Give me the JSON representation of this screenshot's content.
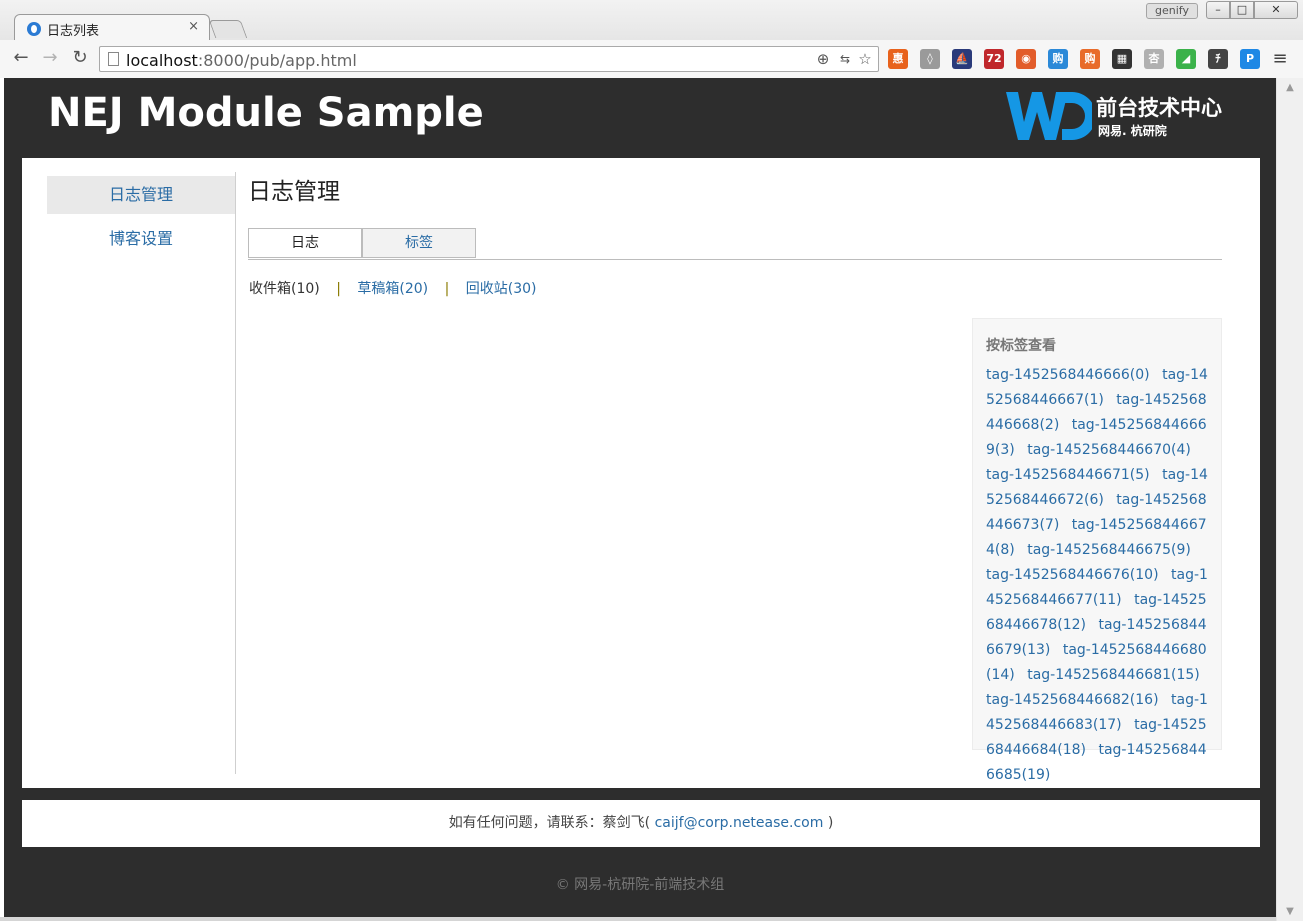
{
  "browser": {
    "tab_title": "日志列表",
    "tab_close": "×",
    "user_badge": "genify",
    "win_min": "–",
    "win_max": "□",
    "win_close": "✕",
    "back": "←",
    "forward": "→",
    "reload": "↻",
    "url_host": "localhost",
    "url_rest": ":8000/pub/app.html",
    "zoom_icon": "⊕",
    "star_icon": "☆",
    "menu_icon": "≡"
  },
  "extensions": [
    {
      "name": "hui-extension-icon",
      "glyph": "惠",
      "color": "#e8621c"
    },
    {
      "name": "shield-extension-icon",
      "glyph": "◊",
      "color": "#9a9a9a"
    },
    {
      "name": "boat-extension-icon",
      "glyph": "⛵",
      "color": "#2a3a7a"
    },
    {
      "name": "badge-extension-icon",
      "glyph": "72",
      "color": "#c0282c"
    },
    {
      "name": "eye-extension-icon",
      "glyph": "◉",
      "color": "#e25c2a"
    },
    {
      "name": "gou-blue-extension-icon",
      "glyph": "购",
      "color": "#2b89d8"
    },
    {
      "name": "gou-orange-extension-icon",
      "glyph": "购",
      "color": "#e86b2a"
    },
    {
      "name": "qrcode-extension-icon",
      "glyph": "▦",
      "color": "#333333"
    },
    {
      "name": "leaf-extension-icon",
      "glyph": "杏",
      "color": "#b0b0b0"
    },
    {
      "name": "flag-extension-icon",
      "glyph": "◢",
      "color": "#3bb24a"
    },
    {
      "name": "tool-extension-icon",
      "glyph": "ﾁ",
      "color": "#444444"
    },
    {
      "name": "p-extension-icon",
      "glyph": "P",
      "color": "#1e88e5"
    }
  ],
  "site": {
    "title": "NEJ Module Sample",
    "logo_line1": "前台技术中心",
    "logo_line2": "网易. 杭研院"
  },
  "sidebar": {
    "items": [
      {
        "label": "日志管理",
        "active": true
      },
      {
        "label": "博客设置",
        "active": false
      }
    ]
  },
  "main": {
    "heading": "日志管理",
    "tabs": [
      "日志",
      "标签"
    ],
    "boxes": {
      "inbox": "收件箱(10)",
      "drafts": "草稿箱(20)",
      "trash": "回收站(30)",
      "sep": "|"
    },
    "tag_panel": {
      "title": "按标签查看",
      "tags": [
        "tag-1452568446666(0)",
        "tag-1452568446667(1)",
        "tag-1452568446668(2)",
        "tag-1452568446669(3)",
        "tag-1452568446670(4)",
        "tag-1452568446671(5)",
        "tag-1452568446672(6)",
        "tag-1452568446673(7)",
        "tag-1452568446674(8)",
        "tag-1452568446675(9)",
        "tag-1452568446676(10)",
        "tag-1452568446677(11)",
        "tag-1452568446678(12)",
        "tag-1452568446679(13)",
        "tag-1452568446680(14)",
        "tag-1452568446681(15)",
        "tag-1452568446682(16)",
        "tag-1452568446683(17)",
        "tag-1452568446684(18)",
        "tag-1452568446685(19)"
      ]
    }
  },
  "footer": {
    "contact_prefix": "如有任何问题，请联系：蔡剑飞(",
    "email": "caijf@corp.netease.com",
    "contact_suffix": ")",
    "copyright": "© 网易-杭研院-前端技术组"
  },
  "colors": {
    "page_bg": "#2d2d2d",
    "link": "#2a6ca5",
    "logo_blue": "#1597e5"
  }
}
